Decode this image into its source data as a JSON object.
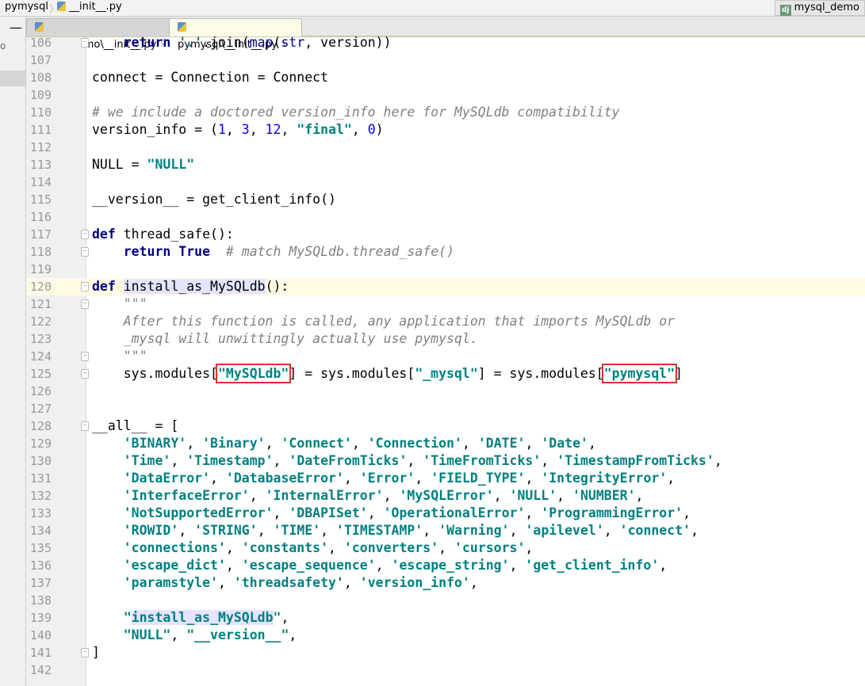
{
  "breadcrumb": [
    "pymysql",
    "__init__.py"
  ],
  "project_button": "mysql_demo",
  "tabs": [
    {
      "label": "mysql_demo\\__init__.py",
      "active": false
    },
    {
      "label": "pymysql\\__init__.py",
      "active": true
    }
  ],
  "left_panel_fragment": "o",
  "current_line": 120,
  "lines": [
    {
      "n": 106,
      "fold": true,
      "t": [
        [
          "pl",
          "    "
        ],
        [
          "kw",
          "return"
        ],
        [
          "pl",
          " "
        ],
        [
          "str",
          "'.'"
        ],
        [
          "pl",
          ".join("
        ],
        [
          "bi",
          "map"
        ],
        [
          "pl",
          "("
        ],
        [
          "bi",
          "str"
        ],
        [
          "pl",
          ", version))"
        ]
      ]
    },
    {
      "n": 107,
      "t": []
    },
    {
      "n": 108,
      "t": [
        [
          "pl",
          "connect = Connection = Connect"
        ]
      ]
    },
    {
      "n": 109,
      "t": []
    },
    {
      "n": 110,
      "t": [
        [
          "cm",
          "# we include a doctored version_info here for MySQLdb compatibility"
        ]
      ]
    },
    {
      "n": 111,
      "t": [
        [
          "pl",
          "version_info = ("
        ],
        [
          "num",
          "1"
        ],
        [
          "pl",
          ", "
        ],
        [
          "num",
          "3"
        ],
        [
          "pl",
          ", "
        ],
        [
          "num",
          "12"
        ],
        [
          "pl",
          ", "
        ],
        [
          "str",
          "\"final\""
        ],
        [
          "pl",
          ", "
        ],
        [
          "num",
          "0"
        ],
        [
          "pl",
          ")"
        ]
      ]
    },
    {
      "n": 112,
      "t": []
    },
    {
      "n": 113,
      "t": [
        [
          "pl",
          "NULL = "
        ],
        [
          "str",
          "\"NULL\""
        ]
      ]
    },
    {
      "n": 114,
      "t": []
    },
    {
      "n": 115,
      "t": [
        [
          "pl",
          "__version__ = get_client_info()"
        ]
      ]
    },
    {
      "n": 116,
      "t": []
    },
    {
      "n": 117,
      "fold": true,
      "t": [
        [
          "kw",
          "def"
        ],
        [
          "pl",
          " thread_safe():"
        ]
      ]
    },
    {
      "n": 118,
      "fold": true,
      "t": [
        [
          "pl",
          "    "
        ],
        [
          "kw",
          "return"
        ],
        [
          "pl",
          " "
        ],
        [
          "kw",
          "True"
        ],
        [
          "pl",
          "  "
        ],
        [
          "cm",
          "# match MySQLdb.thread_safe()"
        ]
      ]
    },
    {
      "n": 119,
      "t": []
    },
    {
      "n": 120,
      "fold": true,
      "t": [
        [
          "kw",
          "def"
        ],
        [
          "pl",
          " "
        ],
        [
          "hl",
          "install_as_MySQLdb"
        ],
        [
          "pl",
          "():"
        ]
      ]
    },
    {
      "n": 121,
      "fold": true,
      "t": [
        [
          "pl",
          "    "
        ],
        [
          "cm",
          "\"\"\""
        ]
      ]
    },
    {
      "n": 122,
      "t": [
        [
          "pl",
          "    "
        ],
        [
          "cm",
          "After this function is called, any application that imports MySQLdb or"
        ]
      ]
    },
    {
      "n": 123,
      "t": [
        [
          "pl",
          "    "
        ],
        [
          "cm",
          "_mysql will unwittingly actually use pymysql."
        ]
      ]
    },
    {
      "n": 124,
      "fold": true,
      "t": [
        [
          "pl",
          "    "
        ],
        [
          "cm",
          "\"\"\""
        ]
      ]
    },
    {
      "n": 125,
      "fold": true,
      "t": [
        [
          "pl",
          "    sys.modules["
        ],
        [
          "strbox",
          "\"MySQLdb\""
        ],
        [
          "pl",
          "] = sys.modules["
        ],
        [
          "str",
          "\"_mysql\""
        ],
        [
          "pl",
          "] = sys.modules["
        ],
        [
          "strbox",
          "\"pymysql\""
        ],
        [
          "pl",
          "]"
        ]
      ]
    },
    {
      "n": 126,
      "t": []
    },
    {
      "n": 127,
      "t": []
    },
    {
      "n": 128,
      "fold": true,
      "t": [
        [
          "pl",
          "__all__ = ["
        ]
      ]
    },
    {
      "n": 129,
      "t": [
        [
          "pl",
          "    "
        ],
        [
          "str",
          "'BINARY'"
        ],
        [
          "pl",
          ", "
        ],
        [
          "str",
          "'Binary'"
        ],
        [
          "pl",
          ", "
        ],
        [
          "str",
          "'Connect'"
        ],
        [
          "pl",
          ", "
        ],
        [
          "str",
          "'Connection'"
        ],
        [
          "pl",
          ", "
        ],
        [
          "str",
          "'DATE'"
        ],
        [
          "pl",
          ", "
        ],
        [
          "str",
          "'Date'"
        ],
        [
          "pl",
          ","
        ]
      ]
    },
    {
      "n": 130,
      "t": [
        [
          "pl",
          "    "
        ],
        [
          "str",
          "'Time'"
        ],
        [
          "pl",
          ", "
        ],
        [
          "str",
          "'Timestamp'"
        ],
        [
          "pl",
          ", "
        ],
        [
          "str",
          "'DateFromTicks'"
        ],
        [
          "pl",
          ", "
        ],
        [
          "str",
          "'TimeFromTicks'"
        ],
        [
          "pl",
          ", "
        ],
        [
          "str",
          "'TimestampFromTicks'"
        ],
        [
          "pl",
          ","
        ]
      ]
    },
    {
      "n": 131,
      "t": [
        [
          "pl",
          "    "
        ],
        [
          "str",
          "'DataError'"
        ],
        [
          "pl",
          ", "
        ],
        [
          "str",
          "'DatabaseError'"
        ],
        [
          "pl",
          ", "
        ],
        [
          "str",
          "'Error'"
        ],
        [
          "pl",
          ", "
        ],
        [
          "str",
          "'FIELD_TYPE'"
        ],
        [
          "pl",
          ", "
        ],
        [
          "str",
          "'IntegrityError'"
        ],
        [
          "pl",
          ","
        ]
      ]
    },
    {
      "n": 132,
      "t": [
        [
          "pl",
          "    "
        ],
        [
          "str",
          "'InterfaceError'"
        ],
        [
          "pl",
          ", "
        ],
        [
          "str",
          "'InternalError'"
        ],
        [
          "pl",
          ", "
        ],
        [
          "str",
          "'MySQLError'"
        ],
        [
          "pl",
          ", "
        ],
        [
          "str",
          "'NULL'"
        ],
        [
          "pl",
          ", "
        ],
        [
          "str",
          "'NUMBER'"
        ],
        [
          "pl",
          ","
        ]
      ]
    },
    {
      "n": 133,
      "t": [
        [
          "pl",
          "    "
        ],
        [
          "str",
          "'NotSupportedError'"
        ],
        [
          "pl",
          ", "
        ],
        [
          "str",
          "'DBAPISet'"
        ],
        [
          "pl",
          ", "
        ],
        [
          "str",
          "'OperationalError'"
        ],
        [
          "pl",
          ", "
        ],
        [
          "str",
          "'ProgrammingError'"
        ],
        [
          "pl",
          ","
        ]
      ]
    },
    {
      "n": 134,
      "t": [
        [
          "pl",
          "    "
        ],
        [
          "str",
          "'ROWID'"
        ],
        [
          "pl",
          ", "
        ],
        [
          "str",
          "'STRING'"
        ],
        [
          "pl",
          ", "
        ],
        [
          "str",
          "'TIME'"
        ],
        [
          "pl",
          ", "
        ],
        [
          "str",
          "'TIMESTAMP'"
        ],
        [
          "pl",
          ", "
        ],
        [
          "str",
          "'Warning'"
        ],
        [
          "pl",
          ", "
        ],
        [
          "str",
          "'apilevel'"
        ],
        [
          "pl",
          ", "
        ],
        [
          "str",
          "'connect'"
        ],
        [
          "pl",
          ","
        ]
      ]
    },
    {
      "n": 135,
      "t": [
        [
          "pl",
          "    "
        ],
        [
          "str",
          "'connections'"
        ],
        [
          "pl",
          ", "
        ],
        [
          "str",
          "'constants'"
        ],
        [
          "pl",
          ", "
        ],
        [
          "str",
          "'converters'"
        ],
        [
          "pl",
          ", "
        ],
        [
          "str",
          "'cursors'"
        ],
        [
          "pl",
          ","
        ]
      ]
    },
    {
      "n": 136,
      "t": [
        [
          "pl",
          "    "
        ],
        [
          "str",
          "'escape_dict'"
        ],
        [
          "pl",
          ", "
        ],
        [
          "str",
          "'escape_sequence'"
        ],
        [
          "pl",
          ", "
        ],
        [
          "str",
          "'escape_string'"
        ],
        [
          "pl",
          ", "
        ],
        [
          "str",
          "'get_client_info'"
        ],
        [
          "pl",
          ","
        ]
      ]
    },
    {
      "n": 137,
      "t": [
        [
          "pl",
          "    "
        ],
        [
          "str",
          "'paramstyle'"
        ],
        [
          "pl",
          ", "
        ],
        [
          "str",
          "'threadsafety'"
        ],
        [
          "pl",
          ", "
        ],
        [
          "str",
          "'version_info'"
        ],
        [
          "pl",
          ","
        ]
      ]
    },
    {
      "n": 138,
      "t": []
    },
    {
      "n": 139,
      "t": [
        [
          "pl",
          "    "
        ],
        [
          "str",
          "\""
        ],
        [
          "strhl",
          "install_as_MySQLdb"
        ],
        [
          "str",
          "\""
        ],
        [
          "pl",
          ","
        ]
      ]
    },
    {
      "n": 140,
      "t": [
        [
          "pl",
          "    "
        ],
        [
          "str",
          "\"NULL\""
        ],
        [
          "pl",
          ", "
        ],
        [
          "str",
          "\"__version__\""
        ],
        [
          "pl",
          ","
        ]
      ]
    },
    {
      "n": 141,
      "fold": true,
      "t": [
        [
          "pl",
          "]"
        ]
      ]
    },
    {
      "n": 142,
      "t": []
    }
  ],
  "colors": {
    "keyword": "#000080",
    "string": "#008080",
    "number": "#0000ff",
    "comment": "#808080",
    "highlight_box": "#e03030"
  }
}
